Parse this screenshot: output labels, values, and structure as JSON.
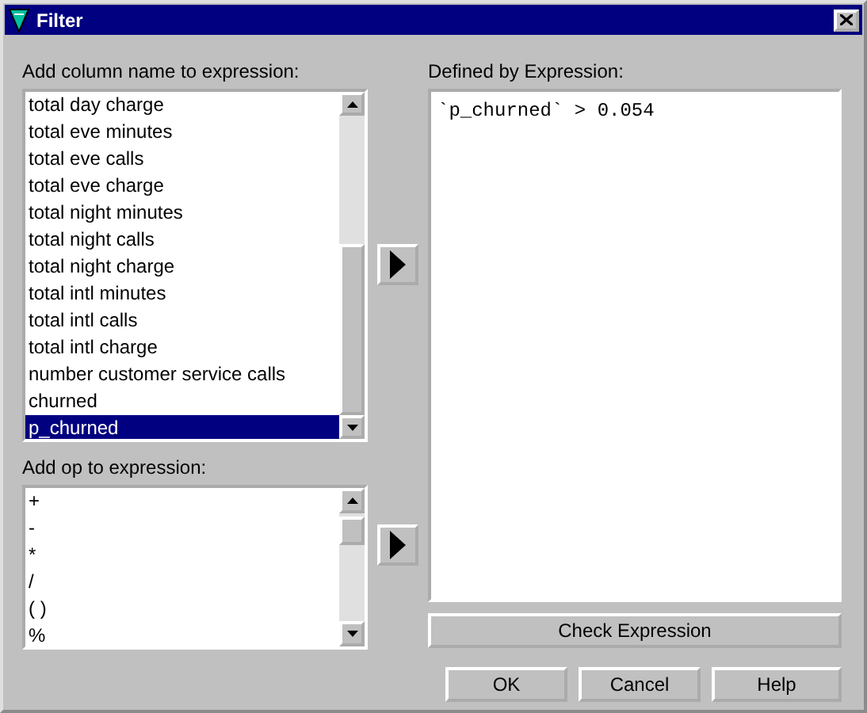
{
  "window": {
    "title": "Filter"
  },
  "columns_list": {
    "label": "Add column name to expression:",
    "items": [
      {
        "text": "total day charge",
        "selected": false
      },
      {
        "text": "total eve minutes",
        "selected": false
      },
      {
        "text": "total eve calls",
        "selected": false
      },
      {
        "text": "total eve charge",
        "selected": false
      },
      {
        "text": "total night minutes",
        "selected": false
      },
      {
        "text": "total night calls",
        "selected": false
      },
      {
        "text": "total night charge",
        "selected": false
      },
      {
        "text": "total intl minutes",
        "selected": false
      },
      {
        "text": "total intl calls",
        "selected": false
      },
      {
        "text": "total intl charge",
        "selected": false
      },
      {
        "text": "number customer service calls",
        "selected": false
      },
      {
        "text": "churned",
        "selected": false
      },
      {
        "text": "p_churned",
        "selected": true
      }
    ]
  },
  "ops_list": {
    "label": "Add op to expression:",
    "items": [
      {
        "text": "+",
        "selected": false
      },
      {
        "text": "-",
        "selected": false
      },
      {
        "text": "*",
        "selected": false
      },
      {
        "text": "/",
        "selected": false
      },
      {
        "text": "( )",
        "selected": false
      },
      {
        "text": "%",
        "selected": false
      }
    ]
  },
  "expression": {
    "label": "Defined by Expression:",
    "value": "`p_churned` > 0.054"
  },
  "check_button": "Check Expression",
  "buttons": [
    "OK",
    "Cancel",
    "Help"
  ]
}
